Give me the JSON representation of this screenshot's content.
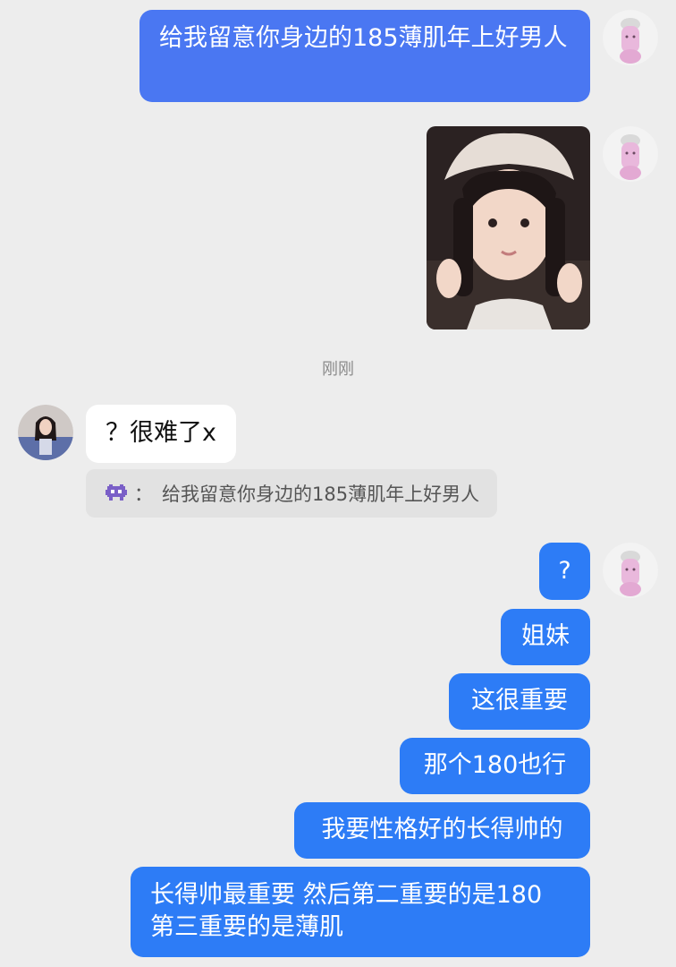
{
  "messages": {
    "m1": "给我留意你身边的185薄肌年上好男人",
    "m2_in": "？很难了x",
    "quote_text": "给我留意你身边的185薄肌年上好男人",
    "quote_sep": "：",
    "m3": "?",
    "m4": "姐妹",
    "m5": "这很重要",
    "m6": "那个180也行",
    "m7": "我要性格好的长得帅的",
    "m8": "长得帅最重要 然后第二重要的是180 第三重要的是薄肌"
  },
  "timestamp": "刚刚",
  "icons": {
    "my_avatar": "pink-pig-chef-avatar",
    "their_avatar": "girl-photo-avatar",
    "quote_icon": "purple-pixel-alien-icon"
  },
  "colors": {
    "background": "#ededed",
    "bubble_out": "#2d7cf6",
    "bubble_out_first": "#4a77f2",
    "bubble_in": "#ffffff",
    "quote_bg": "#e2e2e2"
  }
}
